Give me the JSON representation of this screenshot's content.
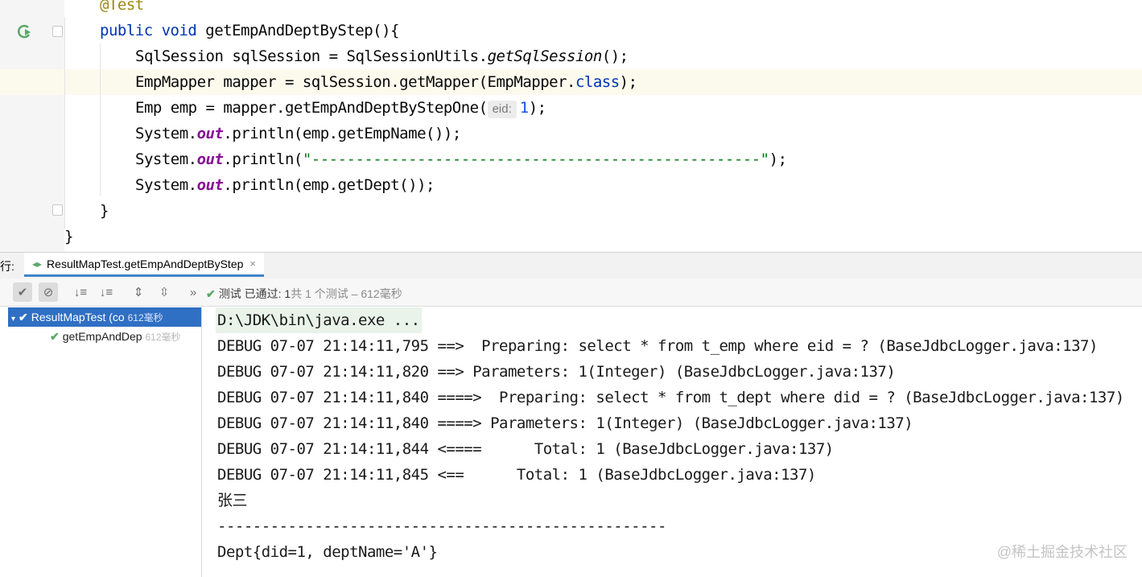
{
  "editor": {
    "lines": {
      "annotation": "@Test",
      "method_kw1": "public",
      "method_kw2": "void",
      "method_sig": " getEmpAndDeptByStep(){",
      "l1_a": "SqlSession sqlSession = SqlSessionUtils.",
      "l1_b": "getSqlSession",
      "l1_c": "();",
      "l2_a": "EmpMapper mapper = sqlSession.getMapper(EmpMapper.",
      "l2_kw": "class",
      "l2_c": ");",
      "l3_a": "Emp emp = mapper.getEmpAndDeptByStepOne(",
      "l3_hint": "eid:",
      "l3_num": "1",
      "l3_c": ");",
      "sys": "System.",
      "out": "out",
      "l4_c": ".println(emp.getEmpName());",
      "l5_b": ".println(",
      "l5_str": "\"---------------------------------------------------\"",
      "l5_c": ");",
      "l6_c": ".println(emp.getDept());",
      "close_method": "}",
      "close_class": "}"
    }
  },
  "tool_window": {
    "label": "行:",
    "tab_title": "ResultMapTest.getEmpAndDeptByStep",
    "tab_close": "×"
  },
  "toolbar": {
    "more": "»",
    "status_check": "✔",
    "status_main": "测试 已通过: 1",
    "status_rest": "共 1 个测试 – 612毫秒"
  },
  "tree": {
    "root_label": "ResultMapTest (co",
    "root_time": "612毫秒",
    "child_label": "getEmpAndDep",
    "child_time": "612毫秒"
  },
  "console": {
    "cmd": "D:\\JDK\\bin\\java.exe ...",
    "lines": [
      "DEBUG 07-07 21:14:11,795 ==>  Preparing: select * from t_emp where eid = ? (BaseJdbcLogger.java:137)",
      "DEBUG 07-07 21:14:11,820 ==> Parameters: 1(Integer) (BaseJdbcLogger.java:137)",
      "DEBUG 07-07 21:14:11,840 ====>  Preparing: select * from t_dept where did = ? (BaseJdbcLogger.java:137)",
      "DEBUG 07-07 21:14:11,840 ====> Parameters: 1(Integer) (BaseJdbcLogger.java:137)",
      "DEBUG 07-07 21:14:11,844 <====      Total: 1 (BaseJdbcLogger.java:137)",
      "DEBUG 07-07 21:14:11,845 <==      Total: 1 (BaseJdbcLogger.java:137)",
      "张三",
      "---------------------------------------------------",
      "Dept{did=1, deptName='A'}"
    ]
  },
  "watermark": "@稀土掘金技术社区",
  "colors": {
    "accent": "#2f6fc4",
    "success": "#59a869",
    "keyword": "#0033b3",
    "string": "#067d17"
  }
}
